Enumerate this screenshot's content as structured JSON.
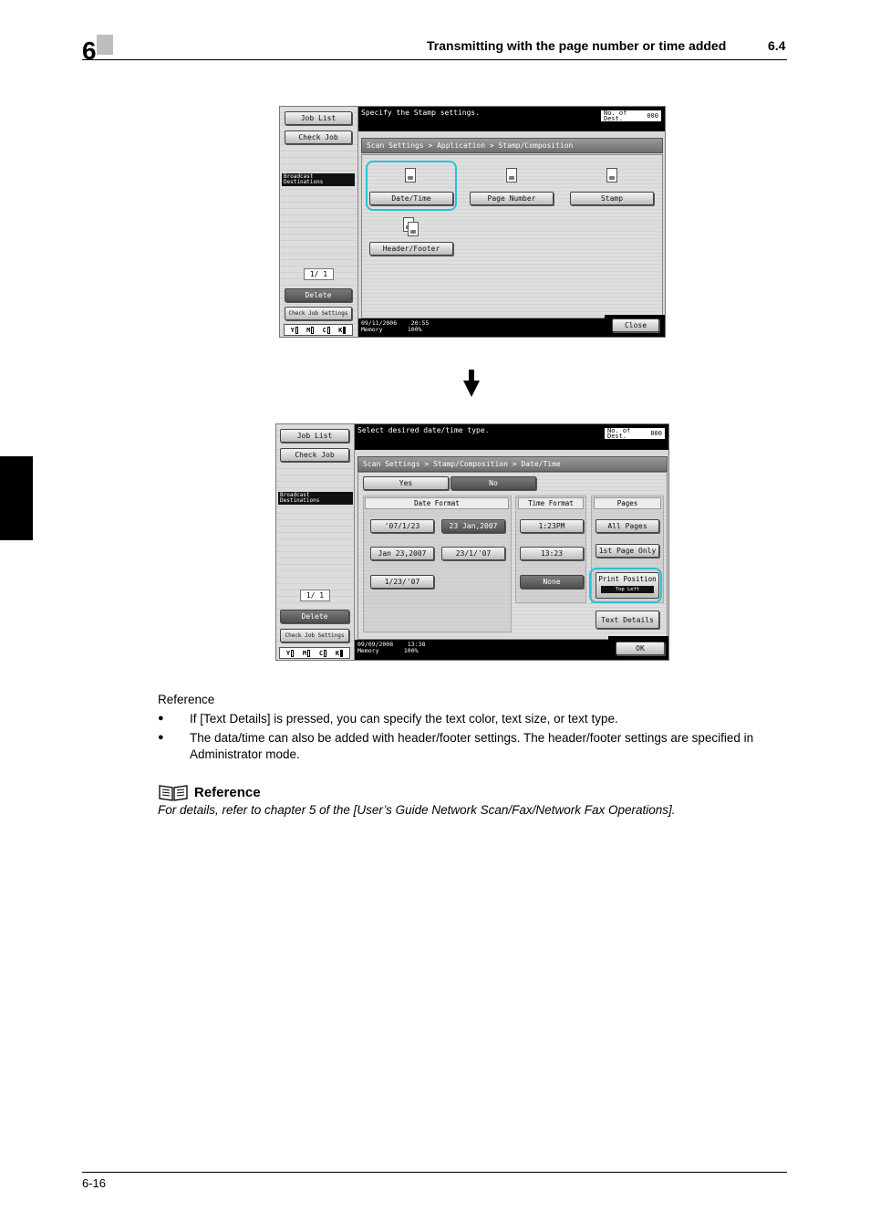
{
  "header": {
    "chapter": "6",
    "title": "Transmitting with the page number or time added",
    "section": "6.4"
  },
  "screen1": {
    "left": {
      "job_list": "Job List",
      "check_job": "Check Job",
      "broadcast": "Broadcast Destinations",
      "page_count": "1/ 1",
      "delete": "Delete",
      "check_job_settings": "Check Job Settings"
    },
    "toner": [
      "Y",
      "M",
      "C",
      "K"
    ],
    "message": "Specify the Stamp settings.",
    "dest_label": "No. of Dest.",
    "dest_count": "000",
    "breadcrumb": "Scan Settings > Application > Stamp/Composition",
    "buttons": {
      "date_time": "Date/Time",
      "page_number": "Page Number",
      "stamp": "Stamp",
      "header_footer": "Header/Footer"
    },
    "status_date": "09/11/2006",
    "status_time": "20:55",
    "memory_label": "Memory",
    "memory_value": "100%",
    "close": "Close"
  },
  "screen2": {
    "left": {
      "job_list": "Job List",
      "check_job": "Check Job",
      "broadcast": "Broadcast Destinations",
      "page_count": "1/ 1",
      "delete": "Delete",
      "check_job_settings": "Check Job Settings"
    },
    "toner": [
      "Y",
      "M",
      "C",
      "K"
    ],
    "message": "Select desired date/time type.",
    "dest_label": "No. of Dest.",
    "dest_count": "000",
    "breadcrumb": "Scan Settings > Stamp/Composition > Date/Time",
    "yes": "Yes",
    "no": "No",
    "date_format_head": "Date Format",
    "time_format_head": "Time Format",
    "pages_head": "Pages",
    "date_formats": [
      "'07/1/23",
      "23 Jan,2007",
      "Jan 23,2007",
      "23/1/'07",
      "1/23/'07"
    ],
    "time_formats": [
      "1:23PM",
      "13:23",
      "None"
    ],
    "pages": {
      "all": "All Pages",
      "first": "1st Page Only"
    },
    "print_position": "Print Position",
    "print_position_value": "Top Left",
    "text_details": "Text Details",
    "status_date": "09/09/2008",
    "status_time": "13:38",
    "memory_label": "Memory",
    "memory_value": "100%",
    "ok": "OK"
  },
  "body": {
    "reference_label": "Reference",
    "bullets": [
      "If [Text Details] is pressed, you can specify the text color, text size, or text type.",
      "The data/time can also be added with header/footer settings. The header/footer settings are specified in Administrator mode."
    ],
    "reference_heading": "Reference",
    "reference_note": "For details, refer to chapter 5 of the [User’s Guide Network Scan/Fax/Network Fax Operations]."
  },
  "footer": {
    "page_number": "6-16"
  }
}
